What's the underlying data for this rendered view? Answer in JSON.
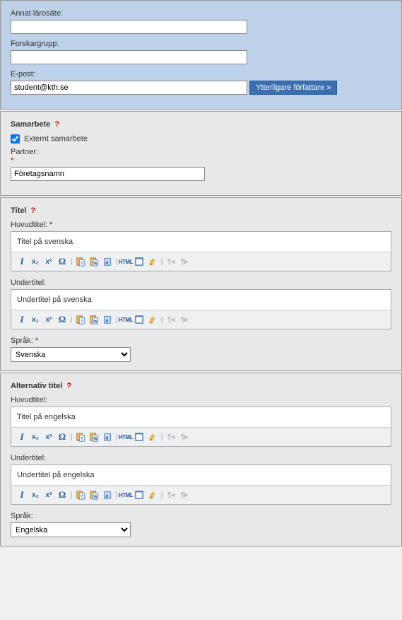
{
  "author_section": {
    "other_institution_label": "Annat lärosäte:",
    "other_institution_value": "",
    "research_group_label": "Forskargrupp:",
    "research_group_value": "",
    "email_label": "E-post:",
    "email_value": "student@kth.se",
    "add_author_button": "Ytterligare författare »"
  },
  "collaboration": {
    "title": "Samarbete",
    "external_label": "Externt samarbete",
    "external_checked": true,
    "partner_label": "Partner:",
    "partner_value": "Företagsnamn"
  },
  "title_section": {
    "heading": "Titel",
    "main_label": "Huvudtitel:",
    "main_value": "Titel på svenska",
    "sub_label": "Undertitel:",
    "sub_value": "Undertitel på svenska",
    "lang_label": "Språk:",
    "lang_value": "Svenska"
  },
  "alt_title_section": {
    "heading": "Alternativ titel",
    "main_label": "Huvudtitel:",
    "main_value": "Titel på engelska",
    "sub_label": "Undertitel:",
    "sub_value": "Undertitel på engelska",
    "lang_label": "Språk:",
    "lang_value": "Engelska"
  },
  "toolbar": {
    "italic": "I",
    "sub": "x₂",
    "sup": "x²",
    "omega": "Ω",
    "html": "HTML"
  },
  "markers": {
    "req": "*",
    "help": "?"
  }
}
